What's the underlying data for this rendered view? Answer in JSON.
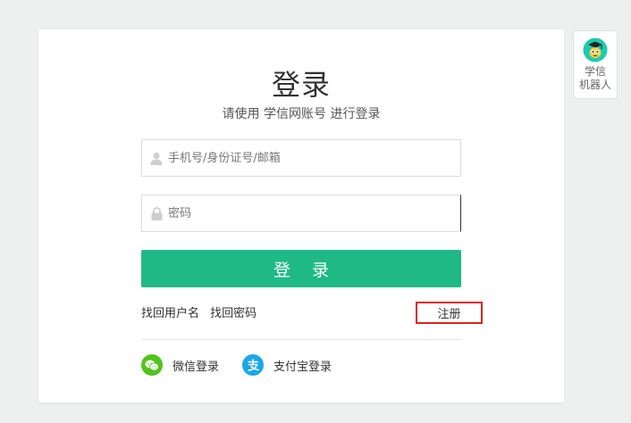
{
  "login": {
    "title": "登录",
    "subtitle": "请使用 学信网账号 进行登录",
    "username_placeholder": "手机号/身份证号/邮箱",
    "password_placeholder": "密码",
    "login_button": "登 录",
    "forgot_username": "找回用户名",
    "forgot_password": "找回密码",
    "register": "注册",
    "wechat_login": "微信登录",
    "alipay_login": "支付宝登录"
  },
  "robot": {
    "label_line1": "学信",
    "label_line2": "机器人"
  },
  "colors": {
    "accent": "#1fb985",
    "wechat": "#52c41a",
    "alipay": "#1aa7e8",
    "highlight_border": "#e02020"
  },
  "icons": [
    "user-icon",
    "lock-icon",
    "wechat-icon",
    "alipay-icon",
    "robot-avatar-icon"
  ]
}
